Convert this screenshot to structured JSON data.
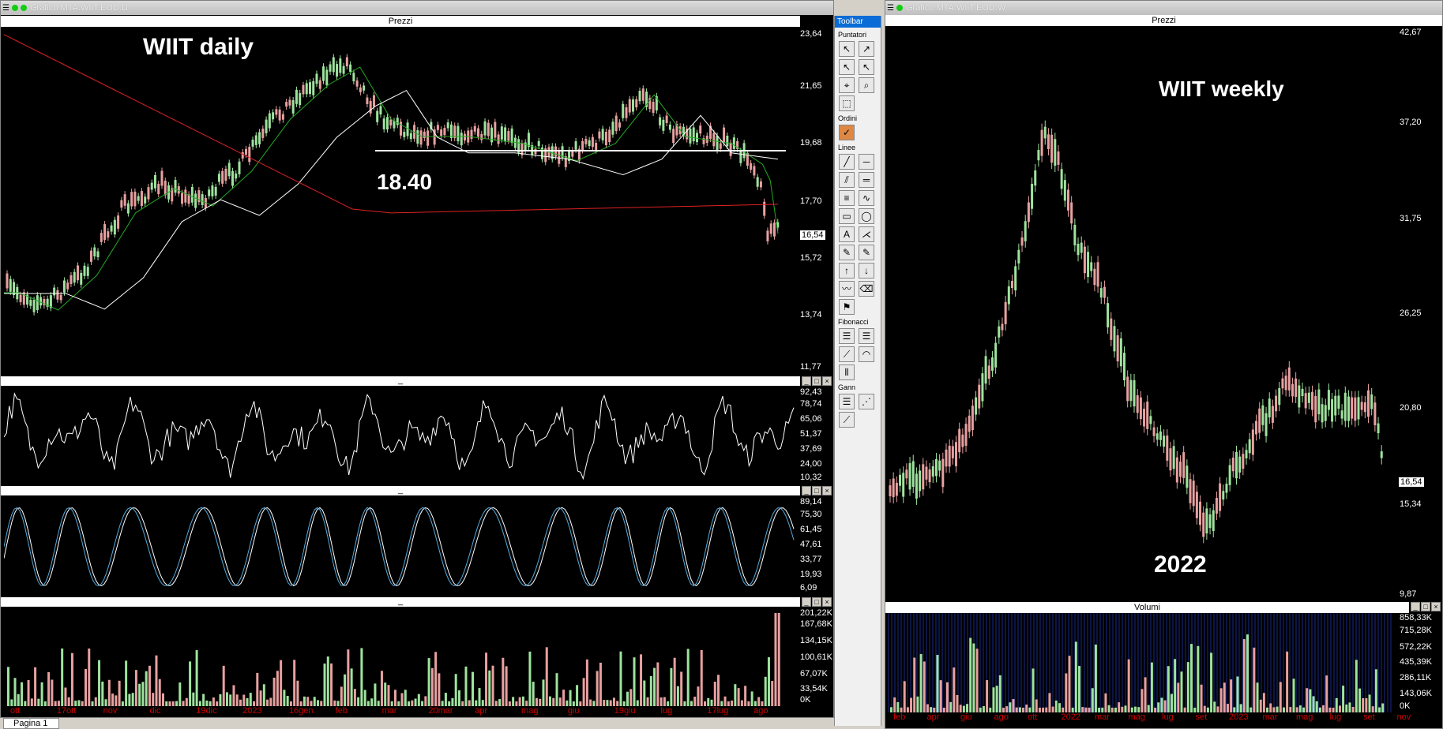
{
  "left_window": {
    "title": "Grafico MTA.WIIT.EOD.D",
    "pane_title": "Prezzi",
    "chart_label": "WIIT daily",
    "level_label": "18.40",
    "price_axis": [
      "23,64",
      "21,65",
      "19,68",
      "17,70",
      "15,72",
      "13,74",
      "11,77"
    ],
    "last_price": "16,54",
    "rsi_axis": [
      "92,43",
      "78,74",
      "65,06",
      "51,37",
      "37,69",
      "24,00",
      "10,32"
    ],
    "stoch_axis": [
      "89,14",
      "75,30",
      "61,45",
      "47,61",
      "33,77",
      "19,93",
      "6,09"
    ],
    "vol_axis": [
      "201,22K",
      "167,68K",
      "134,15K",
      "100,61K",
      "67,07K",
      "33,54K",
      "0K"
    ],
    "x_axis": [
      "ott",
      "17ott",
      "nov",
      "dic",
      "19dic",
      "2023",
      "16gen",
      "feb",
      "mar",
      "20mar",
      "apr",
      "mag",
      "giu",
      "19giu",
      "lug",
      "17lug",
      "ago"
    ],
    "divider": "_"
  },
  "right_window": {
    "title": "Grafico MTA.WIIT.EOD.W",
    "pane_title": "Prezzi",
    "chart_label": "WIIT weekly",
    "year_label": "2022",
    "price_axis": [
      "42,67",
      "37,20",
      "31,75",
      "26,25",
      "20,80",
      "15,34",
      "9,87"
    ],
    "last_price": "16,54",
    "vol_title": "Volumi",
    "vol_axis": [
      "858,33K",
      "715,28K",
      "572,22K",
      "435,39K",
      "286,11K",
      "143,06K",
      "0K"
    ],
    "x_axis": [
      "feb",
      "apr",
      "giu",
      "ago",
      "ott",
      "2022",
      "mar",
      "mag",
      "lug",
      "set",
      "2023",
      "mar",
      "mag",
      "lug",
      "set",
      "nov"
    ]
  },
  "toolbar": {
    "title": "Toolbar",
    "sections": [
      "Puntatori",
      "Ordini",
      "Linee",
      "Fibonacci",
      "Gann"
    ]
  },
  "status": {
    "page_tab": "Pagina 1"
  },
  "colors": {
    "bull": "#9ee39e",
    "bear": "#e8a0a0",
    "ma200": "#d22",
    "ma50": "#fff",
    "ma20": "#2a2",
    "rsi": "#fff",
    "stoch_k": "#5ad",
    "stoch_d": "#fff"
  }
}
